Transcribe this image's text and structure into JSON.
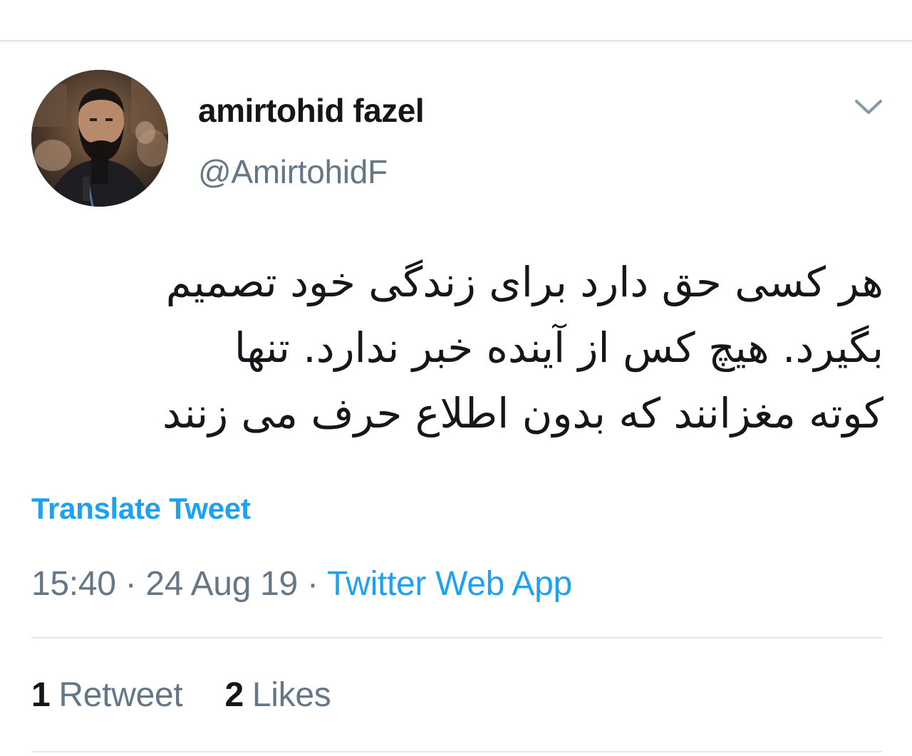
{
  "author": {
    "display_name": "amirtohid fazel",
    "handle": "@AmirtohidF"
  },
  "icons": {
    "avatar": "avatar-photo",
    "menu": "chevron-down-icon"
  },
  "tweet": {
    "lines": [
      "هر کسی حق دارد برای زندگی خود تصمیم",
      "بگیرد. هیچ کس از آینده خبر ندارد. تنها",
      "کوته مغزانند که بدون اطلاع حرف می زنند"
    ],
    "translate_label": "Translate Tweet"
  },
  "meta": {
    "time": "15:40",
    "separator": "·",
    "date": "24 Aug 19",
    "source": "Twitter Web App"
  },
  "stats": {
    "retweets_count": "1",
    "retweets_label": "Retweet",
    "likes_count": "2",
    "likes_label": "Likes"
  },
  "colors": {
    "accent": "#1da1f2",
    "text_primary": "#14171a",
    "text_secondary": "#657786",
    "divider": "#e1e8ed"
  }
}
